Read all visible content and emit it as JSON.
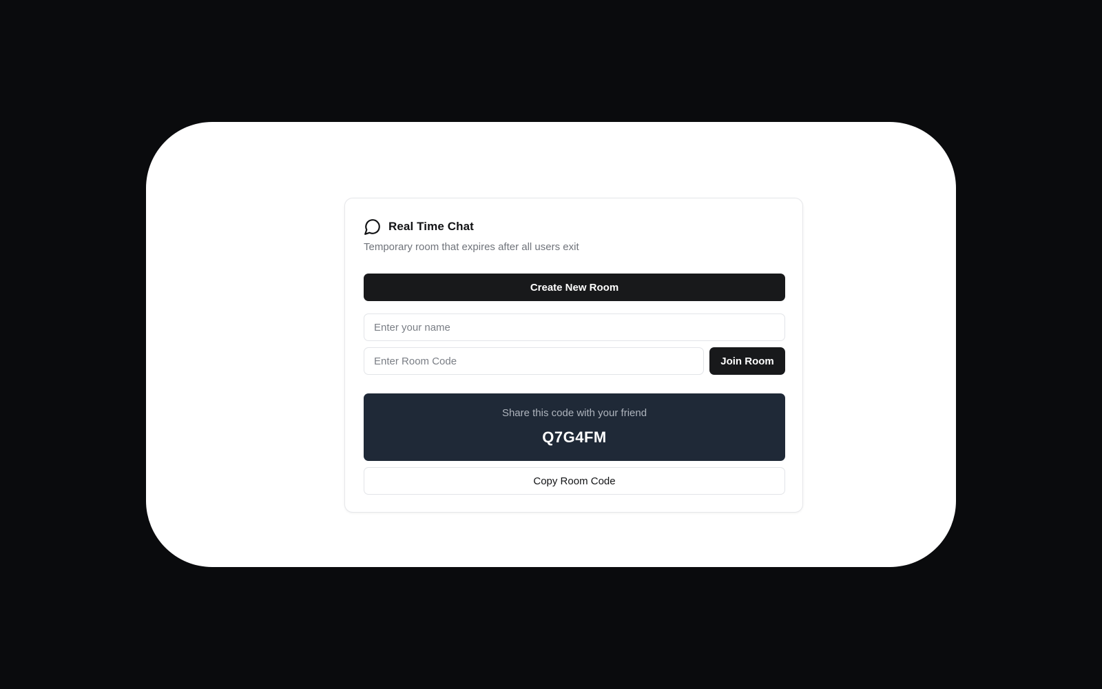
{
  "app": {
    "title": "Real Time Chat",
    "subtitle": "Temporary room that expires after all users exit",
    "icon": "message-circle-icon"
  },
  "actions": {
    "create_room_label": "Create New Room",
    "join_room_label": "Join Room",
    "copy_code_label": "Copy Room Code"
  },
  "form": {
    "name_placeholder": "Enter your name",
    "name_value": "",
    "room_code_placeholder": "Enter Room Code",
    "room_code_value": ""
  },
  "share": {
    "label": "Share this code with your friend",
    "code": "Q7G4FM"
  },
  "colors": {
    "background": "#0a0b0d",
    "frame": "#ffffff",
    "primary_button": "#18191b",
    "share_box": "#1f2937"
  }
}
